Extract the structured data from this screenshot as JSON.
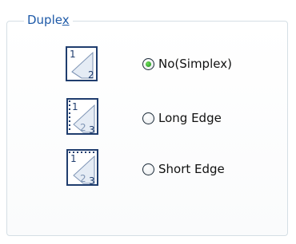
{
  "group": {
    "title_prefix": "Duple",
    "title_mnemonic": "x"
  },
  "options": [
    {
      "label": "No(Simplex)",
      "selected": true,
      "icon": "simplex-page-icon",
      "icon_numbers": [
        "1",
        "2"
      ]
    },
    {
      "label": "Long Edge",
      "selected": false,
      "icon": "long-edge-duplex-icon",
      "icon_numbers": [
        "1",
        "2",
        "3"
      ]
    },
    {
      "label": "Short Edge",
      "selected": false,
      "icon": "short-edge-duplex-icon",
      "icon_numbers": [
        "1",
        "2",
        "3"
      ]
    }
  ],
  "colors": {
    "accent": "#1e5aa8",
    "border": "#d5dfe5",
    "radio_selected": "#2ea12e"
  }
}
